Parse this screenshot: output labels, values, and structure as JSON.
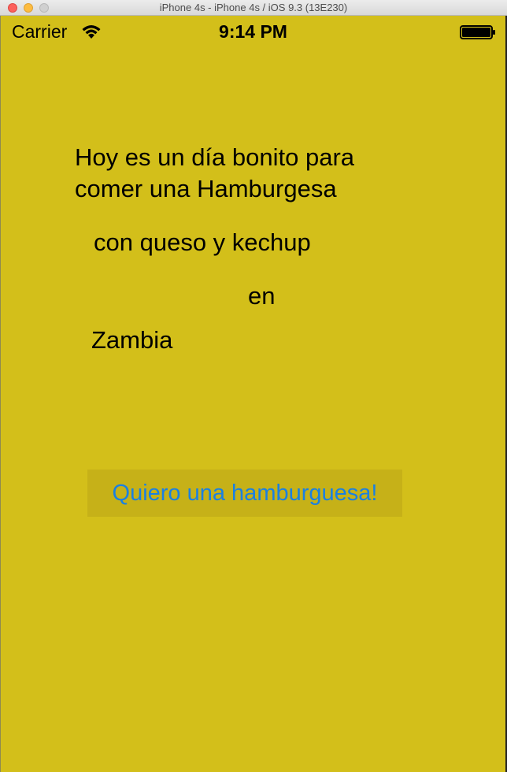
{
  "window": {
    "title": "iPhone 4s - iPhone 4s / iOS 9.3 (13E230)"
  },
  "status_bar": {
    "carrier": "Carrier",
    "time": "9:14 PM"
  },
  "content": {
    "intro": "Hoy es un día bonito para\ncomer una Hamburgesa",
    "line2": "con queso y kechup",
    "line3": "en",
    "line4": "Zambia"
  },
  "button": {
    "label": "Quiero una hamburguesa!"
  },
  "colors": {
    "background": "#d3bf1a",
    "button_background": "#c6b118",
    "button_text": "#1a80e2"
  }
}
